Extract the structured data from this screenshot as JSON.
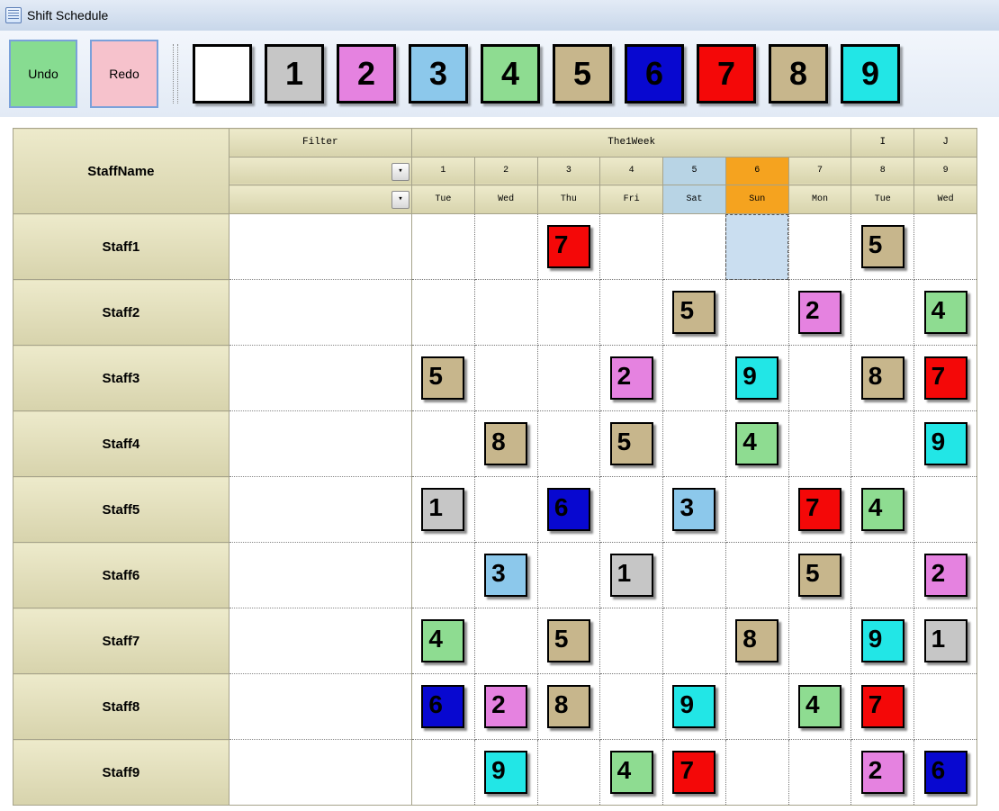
{
  "title": "Shift Schedule",
  "toolbar": {
    "undo": "Undo",
    "redo": "Redo"
  },
  "palette": [
    {
      "v": "",
      "c": "#ffffff"
    },
    {
      "v": "1",
      "c": "#c6c6c6"
    },
    {
      "v": "2",
      "c": "#e582e0"
    },
    {
      "v": "3",
      "c": "#8cc8eb"
    },
    {
      "v": "4",
      "c": "#8edc91"
    },
    {
      "v": "5",
      "c": "#c7b68c"
    },
    {
      "v": "6",
      "c": "#0808d0"
    },
    {
      "v": "7",
      "c": "#f40808"
    },
    {
      "v": "8",
      "c": "#c7b68c"
    },
    {
      "v": "9",
      "c": "#22e6e6"
    }
  ],
  "headers": {
    "staff": "StaffName",
    "filter": "Filter",
    "week": "The1Week",
    "I": "I",
    "J": "J"
  },
  "days": [
    {
      "n": "1",
      "d": "Tue",
      "k": "weekday"
    },
    {
      "n": "2",
      "d": "Wed",
      "k": "weekday"
    },
    {
      "n": "3",
      "d": "Thu",
      "k": "weekday"
    },
    {
      "n": "4",
      "d": "Fri",
      "k": "weekday"
    },
    {
      "n": "5",
      "d": "Sat",
      "k": "sat"
    },
    {
      "n": "6",
      "d": "Sun",
      "k": "sun"
    },
    {
      "n": "7",
      "d": "Mon",
      "k": "weekday"
    },
    {
      "n": "8",
      "d": "Tue",
      "k": "weekday"
    },
    {
      "n": "9",
      "d": "Wed",
      "k": "weekday"
    }
  ],
  "selected": {
    "row": 0,
    "col": 5
  },
  "staff": [
    {
      "name": "Staff1",
      "cells": [
        "",
        "",
        "7",
        "",
        "",
        "",
        "",
        "5",
        ""
      ]
    },
    {
      "name": "Staff2",
      "cells": [
        "",
        "",
        "",
        "",
        "5",
        "",
        "2",
        "",
        "4"
      ]
    },
    {
      "name": "Staff3",
      "cells": [
        "5",
        "",
        "",
        "2",
        "",
        "9",
        "",
        "8",
        "7"
      ]
    },
    {
      "name": "Staff4",
      "cells": [
        "",
        "8",
        "",
        "5",
        "",
        "4",
        "",
        "",
        "9"
      ]
    },
    {
      "name": "Staff5",
      "cells": [
        "1",
        "",
        "6",
        "",
        "3",
        "",
        "7",
        "4",
        ""
      ]
    },
    {
      "name": "Staff6",
      "cells": [
        "",
        "3",
        "",
        "1",
        "",
        "",
        "5",
        "",
        "2"
      ]
    },
    {
      "name": "Staff7",
      "cells": [
        "4",
        "",
        "5",
        "",
        "",
        "8",
        "",
        "9",
        "1"
      ]
    },
    {
      "name": "Staff8",
      "cells": [
        "6",
        "2",
        "8",
        "",
        "9",
        "",
        "4",
        "7",
        ""
      ]
    },
    {
      "name": "Staff9",
      "cells": [
        "",
        "9",
        "",
        "4",
        "7",
        "",
        "",
        "2",
        "6"
      ]
    }
  ]
}
